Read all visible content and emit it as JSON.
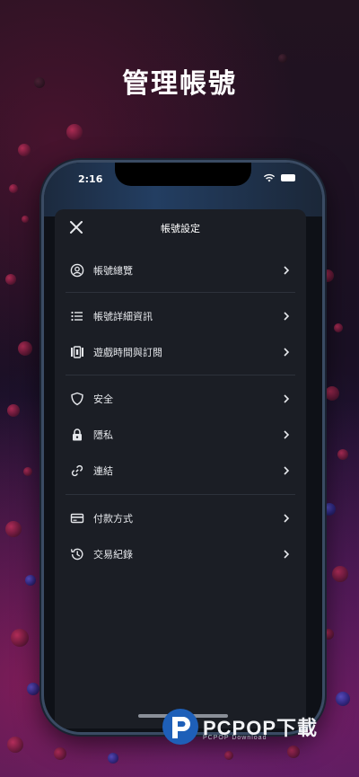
{
  "page": {
    "headline": "管理帳號"
  },
  "status_bar": {
    "time": "2:16",
    "icons": [
      "wifi-icon",
      "battery-icon"
    ]
  },
  "sheet": {
    "title": "帳號設定",
    "close_icon": "close-icon",
    "groups": [
      {
        "items": [
          {
            "label": "帳號總覽",
            "icon": "account-circle-icon"
          }
        ]
      },
      {
        "items": [
          {
            "label": "帳號詳細資訊",
            "icon": "list-icon"
          },
          {
            "label": "遊戲時間與訂閱",
            "icon": "media-frame-icon"
          }
        ]
      },
      {
        "items": [
          {
            "label": "安全",
            "icon": "shield-icon"
          },
          {
            "label": "隱私",
            "icon": "lock-icon"
          },
          {
            "label": "連結",
            "icon": "link-icon"
          }
        ]
      },
      {
        "items": [
          {
            "label": "付款方式",
            "icon": "credit-card-icon"
          },
          {
            "label": "交易紀錄",
            "icon": "history-icon"
          }
        ]
      }
    ]
  },
  "watermark": {
    "brand": "PCPOP下載",
    "sub": "PCPOP Download"
  },
  "colors": {
    "sheet_bg": "#1b1e25",
    "text": "#e6e8ec",
    "divider": "#2d323b",
    "phone_frame": "#3a4b63"
  }
}
